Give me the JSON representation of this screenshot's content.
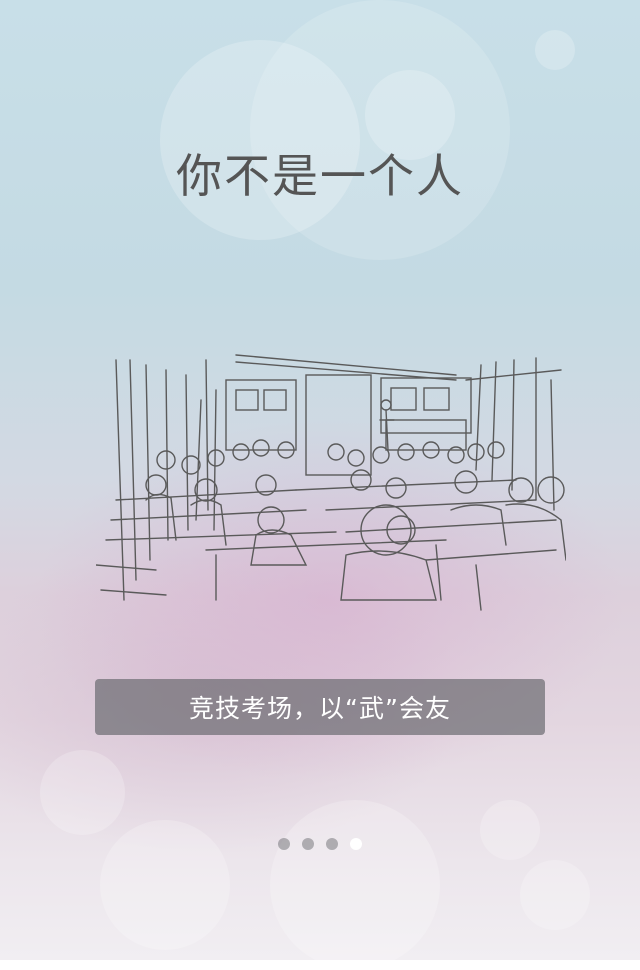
{
  "page": {
    "title": "你不是一个人",
    "caption": "竞技考场，以“武”会友",
    "illustration": "classroom-sketch",
    "pager": {
      "total": 4,
      "active_index": 3
    }
  },
  "colors": {
    "title": "#555555",
    "caption_text": "#ffffff",
    "caption_bar": "#6e6e73",
    "dot_inactive": "#78787d",
    "dot_active": "#ffffff"
  }
}
